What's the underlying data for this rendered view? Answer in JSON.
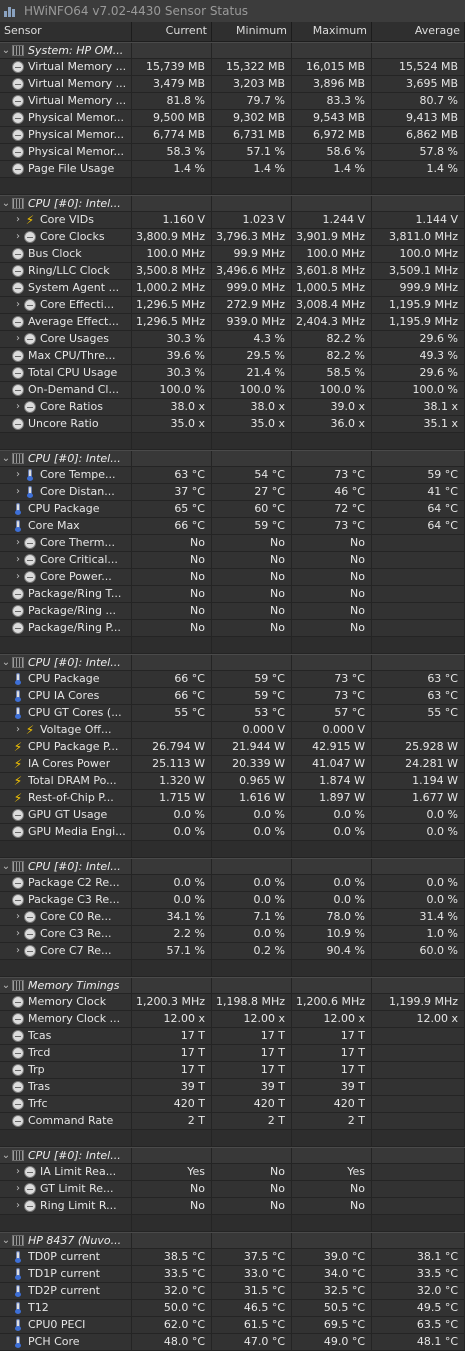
{
  "window": {
    "title": "HWiNFO64 v7.02-4430 Sensor Status"
  },
  "columns": {
    "sensor": "Sensor",
    "current": "Current",
    "minimum": "Minimum",
    "maximum": "Maximum",
    "average": "Average"
  },
  "rows": [
    {
      "t": "group",
      "name": "System: HP OM...",
      "icon": "chip-icon"
    },
    {
      "t": "sensor",
      "name": "Virtual Memory ...",
      "icon": "circle-gauge-icon",
      "cur": "15,739 MB",
      "min": "15,322 MB",
      "max": "16,015 MB",
      "avg": "15,524 MB"
    },
    {
      "t": "sensor",
      "name": "Virtual Memory ...",
      "icon": "circle-gauge-icon",
      "cur": "3,479 MB",
      "min": "3,203 MB",
      "max": "3,896 MB",
      "avg": "3,695 MB"
    },
    {
      "t": "sensor",
      "name": "Virtual Memory ...",
      "icon": "circle-gauge-icon",
      "cur": "81.8 %",
      "min": "79.7 %",
      "max": "83.3 %",
      "avg": "80.7 %"
    },
    {
      "t": "sensor",
      "name": "Physical Memor...",
      "icon": "circle-gauge-icon",
      "cur": "9,500 MB",
      "min": "9,302 MB",
      "max": "9,543 MB",
      "avg": "9,413 MB"
    },
    {
      "t": "sensor",
      "name": "Physical Memor...",
      "icon": "circle-gauge-icon",
      "cur": "6,774 MB",
      "min": "6,731 MB",
      "max": "6,972 MB",
      "avg": "6,862 MB"
    },
    {
      "t": "sensor",
      "name": "Physical Memor...",
      "icon": "circle-gauge-icon",
      "cur": "58.3 %",
      "min": "57.1 %",
      "max": "58.6 %",
      "avg": "57.8 %"
    },
    {
      "t": "sensor",
      "name": "Page File Usage",
      "icon": "circle-gauge-icon",
      "cur": "1.4 %",
      "min": "1.4 %",
      "max": "1.4 %",
      "avg": "1.4 %"
    },
    {
      "t": "blank"
    },
    {
      "t": "group",
      "name": "CPU [#0]: Intel...",
      "icon": "chip-icon"
    },
    {
      "t": "sensor",
      "child": true,
      "name": "Core VIDs",
      "icon": "bolt-icon",
      "cur": "1.160 V",
      "min": "1.023 V",
      "max": "1.244 V",
      "avg": "1.144 V"
    },
    {
      "t": "sensor",
      "child": true,
      "name": "Core Clocks",
      "icon": "circle-gauge-icon",
      "cur": "3,800.9 MHz",
      "min": "3,796.3 MHz",
      "max": "3,901.9 MHz",
      "avg": "3,811.0 MHz"
    },
    {
      "t": "sensor",
      "name": "Bus Clock",
      "icon": "circle-gauge-icon",
      "cur": "100.0 MHz",
      "min": "99.9 MHz",
      "max": "100.0 MHz",
      "avg": "100.0 MHz"
    },
    {
      "t": "sensor",
      "name": "Ring/LLC Clock",
      "icon": "circle-gauge-icon",
      "cur": "3,500.8 MHz",
      "min": "3,496.6 MHz",
      "max": "3,601.8 MHz",
      "avg": "3,509.1 MHz"
    },
    {
      "t": "sensor",
      "name": "System Agent ...",
      "icon": "circle-gauge-icon",
      "cur": "1,000.2 MHz",
      "min": "999.0 MHz",
      "max": "1,000.5 MHz",
      "avg": "999.9 MHz"
    },
    {
      "t": "sensor",
      "child": true,
      "name": "Core Effecti...",
      "icon": "circle-gauge-icon",
      "cur": "1,296.5 MHz",
      "min": "272.9 MHz",
      "max": "3,008.4 MHz",
      "avg": "1,195.9 MHz"
    },
    {
      "t": "sensor",
      "name": "Average Effect...",
      "icon": "circle-gauge-icon",
      "cur": "1,296.5 MHz",
      "min": "939.0 MHz",
      "max": "2,404.3 MHz",
      "avg": "1,195.9 MHz"
    },
    {
      "t": "sensor",
      "child": true,
      "name": "Core Usages",
      "icon": "circle-gauge-icon",
      "cur": "30.3 %",
      "min": "4.3 %",
      "max": "82.2 %",
      "avg": "29.6 %"
    },
    {
      "t": "sensor",
      "name": "Max CPU/Thre...",
      "icon": "circle-gauge-icon",
      "cur": "39.6 %",
      "min": "29.5 %",
      "max": "82.2 %",
      "avg": "49.3 %"
    },
    {
      "t": "sensor",
      "name": "Total CPU Usage",
      "icon": "circle-gauge-icon",
      "cur": "30.3 %",
      "min": "21.4 %",
      "max": "58.5 %",
      "avg": "29.6 %"
    },
    {
      "t": "sensor",
      "name": "On-Demand Cl...",
      "icon": "circle-gauge-icon",
      "cur": "100.0 %",
      "min": "100.0 %",
      "max": "100.0 %",
      "avg": "100.0 %"
    },
    {
      "t": "sensor",
      "child": true,
      "name": "Core Ratios",
      "icon": "circle-gauge-icon",
      "cur": "38.0 x",
      "min": "38.0 x",
      "max": "39.0 x",
      "avg": "38.1 x"
    },
    {
      "t": "sensor",
      "name": "Uncore Ratio",
      "icon": "circle-gauge-icon",
      "cur": "35.0 x",
      "min": "35.0 x",
      "max": "36.0 x",
      "avg": "35.1 x"
    },
    {
      "t": "blank"
    },
    {
      "t": "group",
      "name": "CPU [#0]: Intel...",
      "icon": "chip-icon"
    },
    {
      "t": "sensor",
      "child": true,
      "name": "Core Tempe...",
      "icon": "thermometer-icon",
      "cur": "63 °C",
      "min": "54 °C",
      "max": "73 °C",
      "avg": "59 °C"
    },
    {
      "t": "sensor",
      "child": true,
      "name": "Core Distan...",
      "icon": "thermometer-icon",
      "cur": "37 °C",
      "min": "27 °C",
      "max": "46 °C",
      "avg": "41 °C"
    },
    {
      "t": "sensor",
      "name": "CPU Package",
      "icon": "thermometer-icon",
      "cur": "65 °C",
      "min": "60 °C",
      "max": "72 °C",
      "avg": "64 °C"
    },
    {
      "t": "sensor",
      "name": "Core Max",
      "icon": "thermometer-icon",
      "cur": "66 °C",
      "min": "59 °C",
      "max": "73 °C",
      "avg": "64 °C"
    },
    {
      "t": "sensor",
      "child": true,
      "name": "Core Therm...",
      "icon": "circle-gauge-icon",
      "cur": "No",
      "min": "No",
      "max": "No",
      "avg": ""
    },
    {
      "t": "sensor",
      "child": true,
      "name": "Core Critical...",
      "icon": "circle-gauge-icon",
      "cur": "No",
      "min": "No",
      "max": "No",
      "avg": ""
    },
    {
      "t": "sensor",
      "child": true,
      "name": "Core Power...",
      "icon": "circle-gauge-icon",
      "cur": "No",
      "min": "No",
      "max": "No",
      "avg": ""
    },
    {
      "t": "sensor",
      "name": "Package/Ring T...",
      "icon": "circle-gauge-icon",
      "cur": "No",
      "min": "No",
      "max": "No",
      "avg": ""
    },
    {
      "t": "sensor",
      "name": "Package/Ring ...",
      "icon": "circle-gauge-icon",
      "cur": "No",
      "min": "No",
      "max": "No",
      "avg": ""
    },
    {
      "t": "sensor",
      "name": "Package/Ring P...",
      "icon": "circle-gauge-icon",
      "cur": "No",
      "min": "No",
      "max": "No",
      "avg": ""
    },
    {
      "t": "blank"
    },
    {
      "t": "group",
      "name": "CPU [#0]: Intel...",
      "icon": "chip-icon"
    },
    {
      "t": "sensor",
      "name": "CPU Package",
      "icon": "thermometer-icon",
      "cur": "66 °C",
      "min": "59 °C",
      "max": "73 °C",
      "avg": "63 °C"
    },
    {
      "t": "sensor",
      "name": "CPU IA Cores",
      "icon": "thermometer-icon",
      "cur": "66 °C",
      "min": "59 °C",
      "max": "73 °C",
      "avg": "63 °C"
    },
    {
      "t": "sensor",
      "name": "CPU GT Cores (...",
      "icon": "thermometer-icon",
      "cur": "55 °C",
      "min": "53 °C",
      "max": "57 °C",
      "avg": "55 °C"
    },
    {
      "t": "sensor",
      "child": true,
      "name": "Voltage Off...",
      "icon": "bolt-icon",
      "cur": "",
      "min": "0.000 V",
      "max": "0.000 V",
      "avg": ""
    },
    {
      "t": "sensor",
      "name": "CPU Package P...",
      "icon": "bolt-icon",
      "cur": "26.794 W",
      "min": "21.944 W",
      "max": "42.915 W",
      "avg": "25.928 W"
    },
    {
      "t": "sensor",
      "name": "IA Cores Power",
      "icon": "bolt-icon",
      "cur": "25.113 W",
      "min": "20.339 W",
      "max": "41.047 W",
      "avg": "24.281 W"
    },
    {
      "t": "sensor",
      "name": "Total DRAM Po...",
      "icon": "bolt-icon",
      "cur": "1.320 W",
      "min": "0.965 W",
      "max": "1.874 W",
      "avg": "1.194 W"
    },
    {
      "t": "sensor",
      "name": "Rest-of-Chip P...",
      "icon": "bolt-icon",
      "cur": "1.715 W",
      "min": "1.616 W",
      "max": "1.897 W",
      "avg": "1.677 W"
    },
    {
      "t": "sensor",
      "name": "GPU GT Usage",
      "icon": "circle-gauge-icon",
      "cur": "0.0 %",
      "min": "0.0 %",
      "max": "0.0 %",
      "avg": "0.0 %"
    },
    {
      "t": "sensor",
      "name": "GPU Media Engi...",
      "icon": "circle-gauge-icon",
      "cur": "0.0 %",
      "min": "0.0 %",
      "max": "0.0 %",
      "avg": "0.0 %"
    },
    {
      "t": "blank"
    },
    {
      "t": "group",
      "name": "CPU [#0]: Intel...",
      "icon": "chip-icon"
    },
    {
      "t": "sensor",
      "name": "Package C2 Re...",
      "icon": "circle-gauge-icon",
      "cur": "0.0 %",
      "min": "0.0 %",
      "max": "0.0 %",
      "avg": "0.0 %"
    },
    {
      "t": "sensor",
      "name": "Package C3 Re...",
      "icon": "circle-gauge-icon",
      "cur": "0.0 %",
      "min": "0.0 %",
      "max": "0.0 %",
      "avg": "0.0 %"
    },
    {
      "t": "sensor",
      "child": true,
      "name": "Core C0 Re...",
      "icon": "circle-gauge-icon",
      "cur": "34.1 %",
      "min": "7.1 %",
      "max": "78.0 %",
      "avg": "31.4 %"
    },
    {
      "t": "sensor",
      "child": true,
      "name": "Core C3 Re...",
      "icon": "circle-gauge-icon",
      "cur": "2.2 %",
      "min": "0.0 %",
      "max": "10.9 %",
      "avg": "1.0 %"
    },
    {
      "t": "sensor",
      "child": true,
      "name": "Core C7 Re...",
      "icon": "circle-gauge-icon",
      "cur": "57.1 %",
      "min": "0.2 %",
      "max": "90.4 %",
      "avg": "60.0 %"
    },
    {
      "t": "blank"
    },
    {
      "t": "group",
      "name": "Memory Timings",
      "icon": "chip-icon"
    },
    {
      "t": "sensor",
      "name": "Memory Clock",
      "icon": "circle-gauge-icon",
      "cur": "1,200.3 MHz",
      "min": "1,198.8 MHz",
      "max": "1,200.6 MHz",
      "avg": "1,199.9 MHz"
    },
    {
      "t": "sensor",
      "name": "Memory Clock ...",
      "icon": "circle-gauge-icon",
      "cur": "12.00 x",
      "min": "12.00 x",
      "max": "12.00 x",
      "avg": "12.00 x"
    },
    {
      "t": "sensor",
      "name": "Tcas",
      "icon": "circle-gauge-icon",
      "cur": "17 T",
      "min": "17 T",
      "max": "17 T",
      "avg": ""
    },
    {
      "t": "sensor",
      "name": "Trcd",
      "icon": "circle-gauge-icon",
      "cur": "17 T",
      "min": "17 T",
      "max": "17 T",
      "avg": ""
    },
    {
      "t": "sensor",
      "name": "Trp",
      "icon": "circle-gauge-icon",
      "cur": "17 T",
      "min": "17 T",
      "max": "17 T",
      "avg": ""
    },
    {
      "t": "sensor",
      "name": "Tras",
      "icon": "circle-gauge-icon",
      "cur": "39 T",
      "min": "39 T",
      "max": "39 T",
      "avg": ""
    },
    {
      "t": "sensor",
      "name": "Trfc",
      "icon": "circle-gauge-icon",
      "cur": "420 T",
      "min": "420 T",
      "max": "420 T",
      "avg": ""
    },
    {
      "t": "sensor",
      "name": "Command Rate",
      "icon": "circle-gauge-icon",
      "cur": "2 T",
      "min": "2 T",
      "max": "2 T",
      "avg": ""
    },
    {
      "t": "blank"
    },
    {
      "t": "group",
      "name": "CPU [#0]: Intel...",
      "icon": "chip-icon"
    },
    {
      "t": "sensor",
      "child": true,
      "name": "IA Limit Rea...",
      "icon": "circle-gauge-icon",
      "cur": "Yes",
      "min": "No",
      "max": "Yes",
      "avg": ""
    },
    {
      "t": "sensor",
      "child": true,
      "name": "GT Limit Re...",
      "icon": "circle-gauge-icon",
      "cur": "No",
      "min": "No",
      "max": "No",
      "avg": ""
    },
    {
      "t": "sensor",
      "child": true,
      "name": "Ring Limit R...",
      "icon": "circle-gauge-icon",
      "cur": "No",
      "min": "No",
      "max": "No",
      "avg": ""
    },
    {
      "t": "blank"
    },
    {
      "t": "group",
      "name": "HP 8437 (Nuvo...",
      "icon": "chip-icon"
    },
    {
      "t": "sensor",
      "name": "TD0P current",
      "icon": "thermometer-icon",
      "cur": "38.5 °C",
      "min": "37.5 °C",
      "max": "39.0 °C",
      "avg": "38.1 °C"
    },
    {
      "t": "sensor",
      "name": "TD1P current",
      "icon": "thermometer-icon",
      "cur": "33.5 °C",
      "min": "33.0 °C",
      "max": "34.0 °C",
      "avg": "33.5 °C"
    },
    {
      "t": "sensor",
      "name": "TD2P current",
      "icon": "thermometer-icon",
      "cur": "32.0 °C",
      "min": "31.5 °C",
      "max": "32.5 °C",
      "avg": "32.0 °C"
    },
    {
      "t": "sensor",
      "name": "T12",
      "icon": "thermometer-icon",
      "cur": "50.0 °C",
      "min": "46.5 °C",
      "max": "50.5 °C",
      "avg": "49.5 °C"
    },
    {
      "t": "sensor",
      "name": "CPU0 PECI",
      "icon": "thermometer-icon",
      "cur": "62.0 °C",
      "min": "61.5 °C",
      "max": "69.5 °C",
      "avg": "63.5 °C"
    },
    {
      "t": "sensor",
      "name": "PCH Core",
      "icon": "thermometer-icon",
      "cur": "48.0 °C",
      "min": "47.0 °C",
      "max": "49.0 °C",
      "avg": "48.1 °C"
    }
  ]
}
